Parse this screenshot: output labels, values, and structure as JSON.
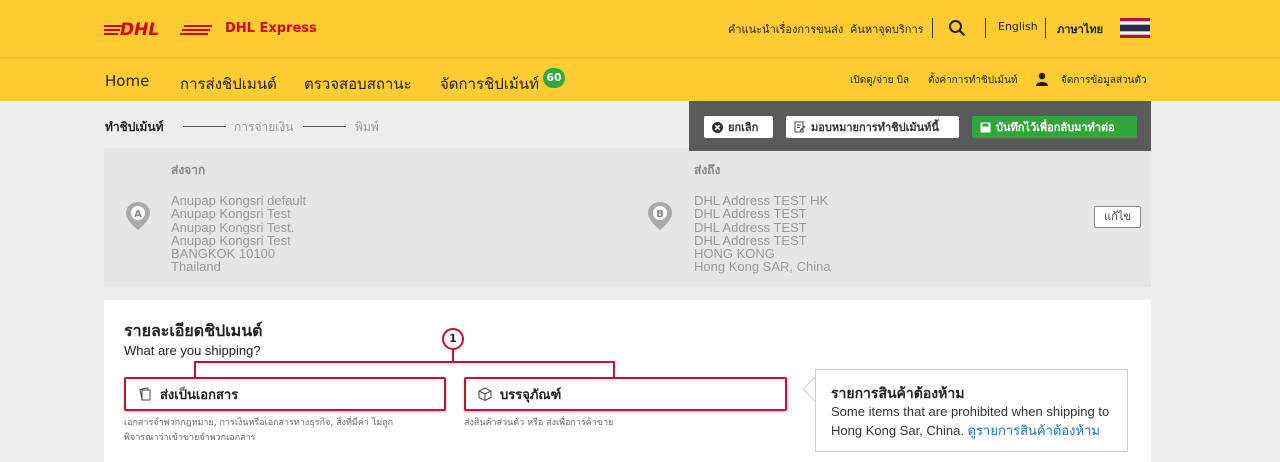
{
  "header": {
    "brand": "DHL Express",
    "links": [
      "คำแนะนำเรื่องการขนส่ง",
      "ค้นหาจุดบริการ"
    ],
    "lang_en": "English",
    "lang_th": "ภาษาไทย",
    "colors": {
      "yellow": "#ffcc33",
      "red": "#d40511",
      "green": "#31a63a"
    }
  },
  "nav": {
    "home": "Home",
    "ship": "การส่งชิปเมนต์",
    "track": "ตรวจสอบสถานะ",
    "manage": "จัดการชิปเม้นท์",
    "manage_badge": "60",
    "right": [
      "เปิดดู/จ่าย บิล",
      "ตั้งค่าการทำชิปเม้นท์",
      "จัดการข้อมูลส่วนตัว"
    ]
  },
  "steps": {
    "s1": "ทำชิปเม้นท์",
    "s2": "การจ่ายเงิน",
    "s3": "พิมพ์"
  },
  "actions": {
    "cancel": "ยกเลิก",
    "delegate": "มอบหมายการทำชิปเม้นท์นี้",
    "save": "บันทึกไว้เพื่อกลับมาทำต่อ"
  },
  "address": {
    "from_title": "ส่งจาก",
    "from_pin": "A",
    "from_lines": [
      "Anupap Kongsri default",
      "Anupap Kongsri Test",
      "Anupap Kongsri Test.",
      "Anupap Kongsri Test",
      "BANGKOK 10100",
      "Thailand"
    ],
    "to_title": "ส่งถึง",
    "to_pin": "B",
    "to_lines": [
      "DHL Address TEST HK",
      "DHL Address TEST",
      "DHL Address TEST",
      "DHL Address TEST",
      "HONG KONG",
      "Hong Kong SAR, China"
    ],
    "edit": "แก้ไข"
  },
  "details": {
    "title": "รายละเอียดชิปเมนต์",
    "subtitle": "What are you shipping?",
    "callout_number": "1",
    "doc_label": "ส่งเป็นเอกสาร",
    "doc_desc_1": "เอกสารจำพวกกฎหมาย, การเงินหรือเอกสารทางธุรกิจ, สิ่งที่มีค่า ไม่ถูก",
    "doc_desc_2": "พิจารณาว่าเข้าข่ายจำพวกเอกสาร",
    "pkg_label": "บรรจุภัณฑ์",
    "pkg_desc": "ส่งสินค้าส่วนตัว หรือ ส่งเพื่อการค้าขาย"
  },
  "prohibited": {
    "title": "รายการสินค้าต้องห้าม",
    "text": "Some items that are prohibited when shipping to Hong Kong Sar, China.",
    "link": "ดูรายการสินค้าต้องห้าม"
  }
}
